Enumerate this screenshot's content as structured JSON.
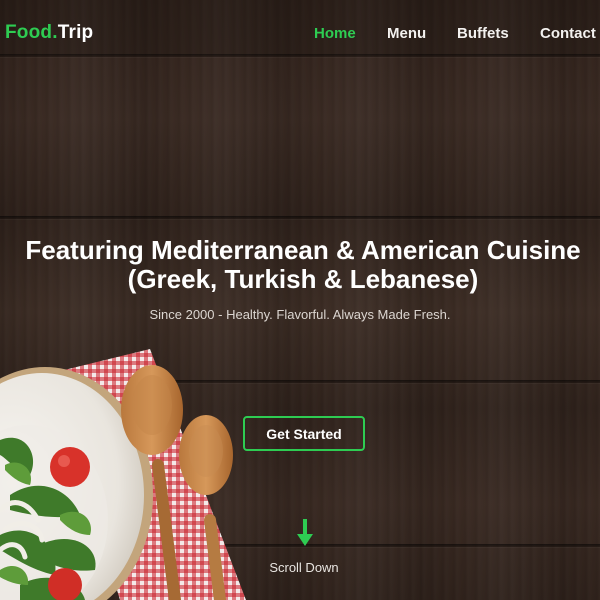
{
  "brand": {
    "name_part1": "Food",
    "separator": ".",
    "name_part2": "Trip",
    "accent_color": "#2ecc52"
  },
  "nav": {
    "items": [
      {
        "label": "Home",
        "active": true
      },
      {
        "label": "Menu",
        "active": false
      },
      {
        "label": "Buffets",
        "active": false
      },
      {
        "label": "Contact",
        "active": false
      }
    ]
  },
  "hero": {
    "headline": "Featuring Mediterranean & American Cuisine (Greek, Turkish & Lebanese)",
    "subline": "Since 2000 - Healthy. Flavorful. Always Made Fresh.",
    "cta_label": "Get Started",
    "scroll_label": "Scroll Down",
    "scroll_icon": "arrow-down-icon",
    "background_image": "wood-table-with-salad-bowl-spoons-and-checkered-napkin"
  }
}
